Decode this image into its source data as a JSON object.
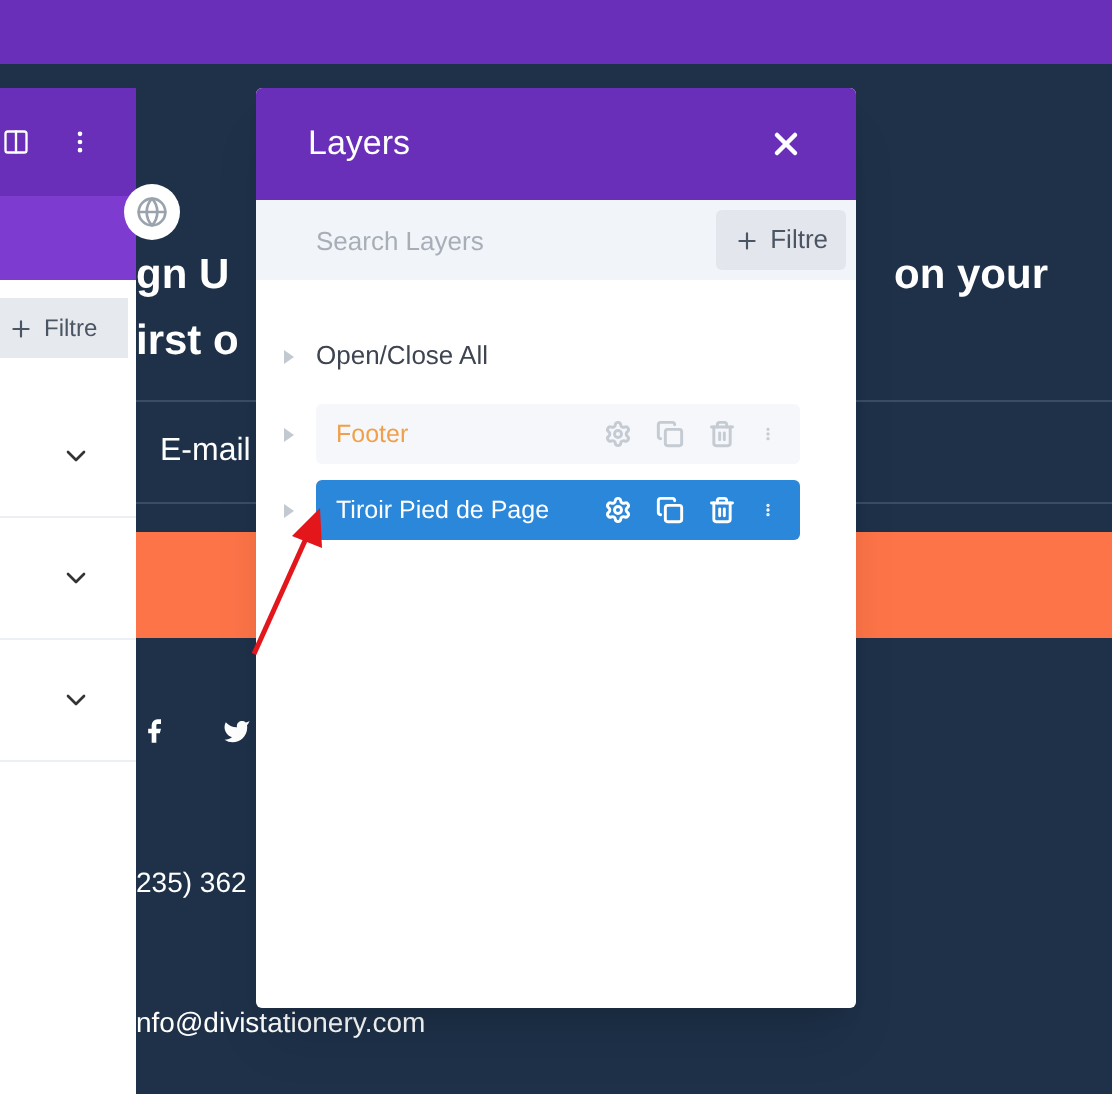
{
  "background_page": {
    "heading_left": [
      "gn U",
      "irst o"
    ],
    "heading_right": "on your",
    "email_placeholder": "E-mail",
    "phone": "235) 362",
    "email": "nfo@divistationery.com"
  },
  "settings_panel": {
    "filter_button": "Filtre",
    "rows": [
      {
        "expanded": false
      },
      {
        "expanded": false
      },
      {
        "expanded": false
      }
    ]
  },
  "layers_panel": {
    "title": "Layers",
    "search": {
      "placeholder": "Search Layers"
    },
    "filter_button": "Filtre",
    "open_close_all": "Open/Close All",
    "layers": [
      {
        "label": "Footer",
        "selected": false
      },
      {
        "label": "Tiroir Pied de Page",
        "selected": true
      }
    ]
  }
}
